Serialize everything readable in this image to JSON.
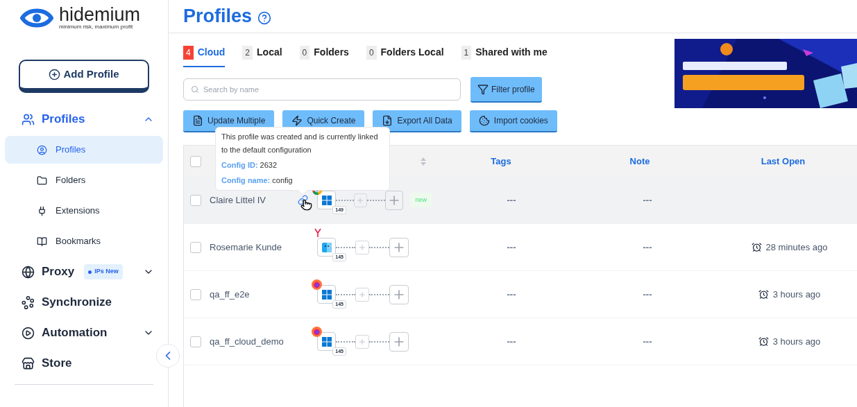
{
  "brand": {
    "name": "hidemium",
    "tagline": "minimum risk, maximum profit"
  },
  "add_profile": "Add Profile",
  "sidebar": {
    "items": [
      {
        "kind": "users",
        "label": "Profiles",
        "expanded": true,
        "children": [
          {
            "kind": "user",
            "label": "Profiles",
            "selected": true
          },
          {
            "kind": "folder",
            "label": "Folders",
            "selected": false
          },
          {
            "kind": "plugin",
            "label": "Extensions",
            "selected": false
          },
          {
            "kind": "book",
            "label": "Bookmarks",
            "selected": false
          }
        ]
      },
      {
        "kind": "globe",
        "label": "Proxy",
        "badge": "IPs New",
        "expanded": false
      },
      {
        "kind": "sync",
        "label": "Synchronize"
      },
      {
        "kind": "automation",
        "label": "Automation",
        "expanded": false
      },
      {
        "kind": "store",
        "label": "Store"
      }
    ]
  },
  "page_title": "Profiles",
  "tabs": [
    {
      "count": "4",
      "label": "Cloud",
      "selected": true
    },
    {
      "count": "2",
      "label": "Local",
      "selected": false
    },
    {
      "count": "0",
      "label": "Folders",
      "selected": false
    },
    {
      "count": "0",
      "label": "Folders Local",
      "selected": false
    },
    {
      "count": "1",
      "label": "Shared with me",
      "selected": false
    }
  ],
  "search": {
    "placeholder": "Search by name"
  },
  "filter_button": "Filter profile",
  "actions": [
    {
      "kind": "update",
      "label": "Update Multiple"
    },
    {
      "kind": "create",
      "label": "Quick Create"
    },
    {
      "kind": "export",
      "label": "Export All Data"
    },
    {
      "kind": "cookies",
      "label": "Import cookies"
    }
  ],
  "tooltip": {
    "text": "This profile was created and is currently linked to the default configuration",
    "fields": [
      {
        "label": "Config ID:",
        "value": "2632"
      },
      {
        "label": "Config name:",
        "value": "config"
      }
    ]
  },
  "table": {
    "select_all": {
      "checked": false
    },
    "columns": [
      "Tags",
      "Note",
      "Last Open"
    ],
    "rows": [
      {
        "checked": false,
        "name": "Claire Littel IV",
        "linked": true,
        "selected": true,
        "browser": {
          "kind": "chrome"
        },
        "os": {
          "kind": "windows"
        },
        "version": "149",
        "badge": "new",
        "tags": "---",
        "note": "---"
      },
      {
        "checked": false,
        "name": "Rosemarie Kunde",
        "linked": false,
        "selected": false,
        "browser": {
          "kind": "yandex"
        },
        "os": {
          "kind": "macos"
        },
        "version": "145",
        "tags": "---",
        "note": "---",
        "last_open": "28 minutes ago"
      },
      {
        "checked": false,
        "name": "qa_ff_e2e",
        "linked": false,
        "selected": false,
        "browser": {
          "kind": "firefox"
        },
        "os": {
          "kind": "windows"
        },
        "version": "145",
        "tags": "---",
        "note": "---",
        "last_open": "3 hours ago"
      },
      {
        "checked": false,
        "name": "qa_ff_cloud_demo",
        "linked": false,
        "selected": false,
        "browser": {
          "kind": "firefox"
        },
        "os": {
          "kind": "windows"
        },
        "version": "145",
        "tags": "---",
        "note": "---",
        "last_open": "3 hours ago"
      }
    ]
  }
}
